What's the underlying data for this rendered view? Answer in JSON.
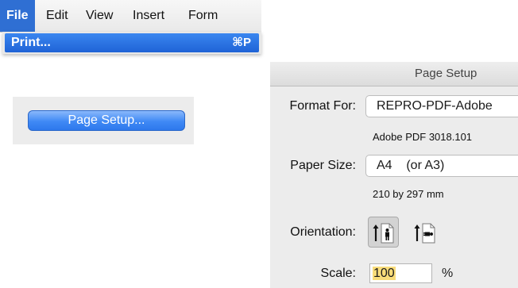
{
  "menubar": {
    "items": [
      {
        "label": "File",
        "active": true
      },
      {
        "label": "Edit",
        "active": false
      },
      {
        "label": "View",
        "active": false
      },
      {
        "label": "Insert",
        "active": false
      },
      {
        "label": "Form",
        "active": false
      }
    ],
    "dropdown": {
      "item_label": "Print...",
      "item_shortcut": "⌘P"
    }
  },
  "page_setup_button": {
    "label": "Page Setup..."
  },
  "dialog": {
    "title": "Page Setup",
    "format_for": {
      "label": "Format For:",
      "value": "REPRO-PDF-Adobe",
      "detail": "Adobe PDF 3018.101"
    },
    "paper_size": {
      "label": "Paper Size:",
      "value": "A4    (or A3)",
      "detail": "210 by 297 mm"
    },
    "orientation": {
      "label": "Orientation:",
      "options": [
        {
          "icon": "portrait-orientation-icon",
          "selected": true
        },
        {
          "icon": "landscape-orientation-icon",
          "selected": false
        }
      ]
    },
    "scale": {
      "label": "Scale:",
      "value": "100",
      "unit": "%"
    }
  },
  "colors": {
    "menu_highlight": "#2f6fd3",
    "button_blue": "#3f89f5",
    "selection_yellow": "#f8dc7a",
    "dialog_bg": "#ececec"
  }
}
